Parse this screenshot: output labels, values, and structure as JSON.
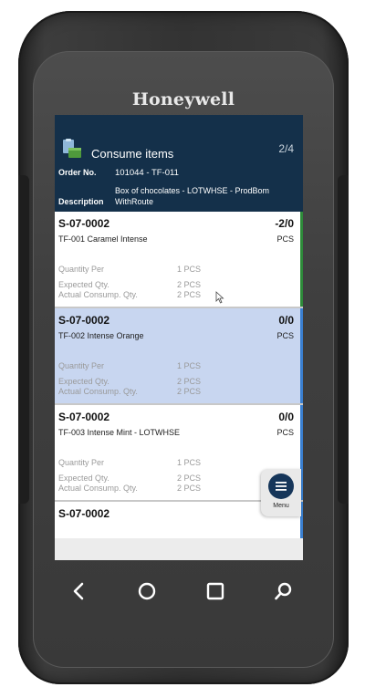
{
  "device": {
    "brand": "Honeywell"
  },
  "header": {
    "icon": "clipboard-box-icon",
    "title": "Consume items",
    "page_indicator": "2/4",
    "order_label": "Order No.",
    "order_value": "101044 - TF-011",
    "description_label": "Description",
    "description_value": "Box of chocolates - LOTWHSE - ProdBom WithRoute"
  },
  "labels": {
    "quantity_per": "Quantity Per",
    "expected_qty": "Expected Qty.",
    "actual_qty": "Actual Consump. Qty."
  },
  "items": [
    {
      "code": "S-07-0002",
      "qty": "-2/0",
      "name": "TF-001  Caramel Intense",
      "unit": "PCS",
      "quantity_per": "1 PCS",
      "expected": "2 PCS",
      "actual": "2 PCS",
      "status_color": "#2e8b3a",
      "selected": false
    },
    {
      "code": "S-07-0002",
      "qty": "0/0",
      "name": "TF-002  Intense Orange",
      "unit": "PCS",
      "quantity_per": "1 PCS",
      "expected": "2 PCS",
      "actual": "2 PCS",
      "status_color": "#3a7fd0",
      "selected": true
    },
    {
      "code": "S-07-0002",
      "qty": "0/0",
      "name": "TF-003  Intense Mint - LOTWHSE",
      "unit": "PCS",
      "quantity_per": "1 PCS",
      "expected": "2 PCS",
      "actual": "2 PCS",
      "status_color": "#3a7fd0",
      "selected": false
    },
    {
      "code": "S-07-0002",
      "status_color": "#3a7fd0",
      "selected": false
    }
  ],
  "menu": {
    "label": "Menu",
    "icon": "hamburger-icon"
  },
  "nav": {
    "back": "back-icon",
    "home": "home-icon",
    "recents": "recents-icon",
    "search": "search-icon"
  },
  "colors": {
    "header_bg": "#14304a",
    "selected_bg": "#c8d6f0",
    "accent_green": "#2e8b3a",
    "accent_blue": "#3a7fd0"
  }
}
